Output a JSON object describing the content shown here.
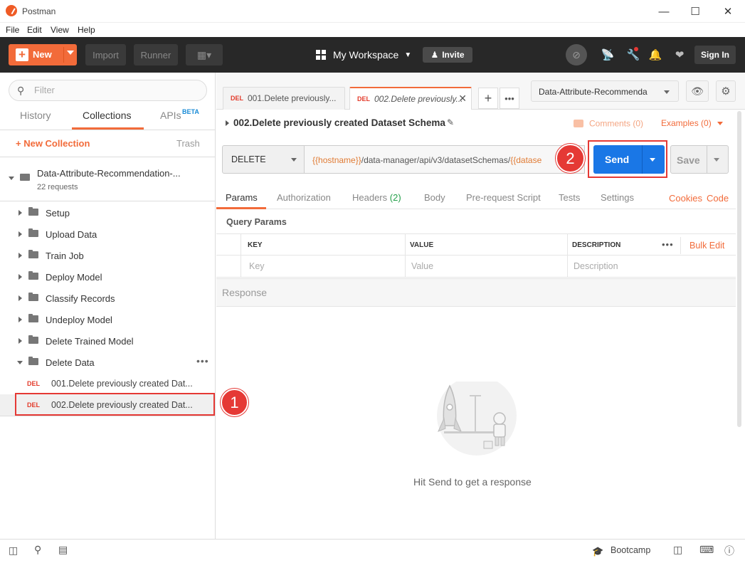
{
  "window": {
    "title": "Postman",
    "controls": [
      "minimize",
      "maximize",
      "close"
    ]
  },
  "menu": [
    "File",
    "Edit",
    "View",
    "Help"
  ],
  "header": {
    "new_label": "New",
    "import_label": "Import",
    "runner_label": "Runner",
    "workspace_label": "My Workspace",
    "invite_label": "Invite",
    "signin_label": "Sign In",
    "icons": [
      "sync-off-icon",
      "satellite-icon",
      "wrench-icon",
      "bell-icon",
      "heart-icon"
    ]
  },
  "sidebar": {
    "filter_placeholder": "Filter",
    "tabs": [
      "History",
      "Collections",
      "APIs"
    ],
    "beta_label": "BETA",
    "new_collection_label": "+ New Collection",
    "trash_label": "Trash",
    "collection": {
      "name": "Data-Attribute-Recommendation-...",
      "count": "22 requests"
    },
    "folders": [
      "Setup",
      "Upload Data",
      "Train Job",
      "Deploy Model",
      "Classify Records",
      "Undeploy Model",
      "Delete Trained Model",
      "Delete Data"
    ],
    "requests": [
      {
        "method": "DEL",
        "label": "001.Delete previously created Dat..."
      },
      {
        "method": "DEL",
        "label": "002.Delete previously created Dat..."
      }
    ],
    "callout": "1"
  },
  "tabs": [
    {
      "method": "DEL",
      "label": "001.Delete previously..."
    },
    {
      "method": "DEL",
      "label": "002.Delete previously..."
    }
  ],
  "environment": {
    "selected": "Data-Attribute-Recommenda"
  },
  "request": {
    "title": "002.Delete previously created Dataset Schema",
    "comments_label": "Comments (0)",
    "examples_label": "Examples (0)",
    "method": "DELETE",
    "url_var1": "{{hostname}}",
    "url_path": "/data-manager/api/v3/datasetSchemas/",
    "url_var2": "{{datase",
    "send_label": "Send",
    "save_label": "Save",
    "callout": "2"
  },
  "subtabs": {
    "params": "Params",
    "authorization": "Authorization",
    "headers": "Headers",
    "headers_count": "(2)",
    "body": "Body",
    "prerequest": "Pre-request Script",
    "tests": "Tests",
    "settings": "Settings",
    "cookies": "Cookies",
    "code": "Code"
  },
  "query_params": {
    "title": "Query Params",
    "headers": [
      "KEY",
      "VALUE",
      "DESCRIPTION"
    ],
    "placeholders": [
      "Key",
      "Value",
      "Description"
    ],
    "bulk_edit": "Bulk Edit"
  },
  "response": {
    "label": "Response",
    "empty_text": "Hit Send to get a response"
  },
  "statusbar": {
    "bootcamp_label": "Bootcamp"
  },
  "colors": {
    "accent": "#f26b3a",
    "send": "#1a77e6",
    "delete_method": "#e33b2b",
    "callout": "#e53935"
  }
}
